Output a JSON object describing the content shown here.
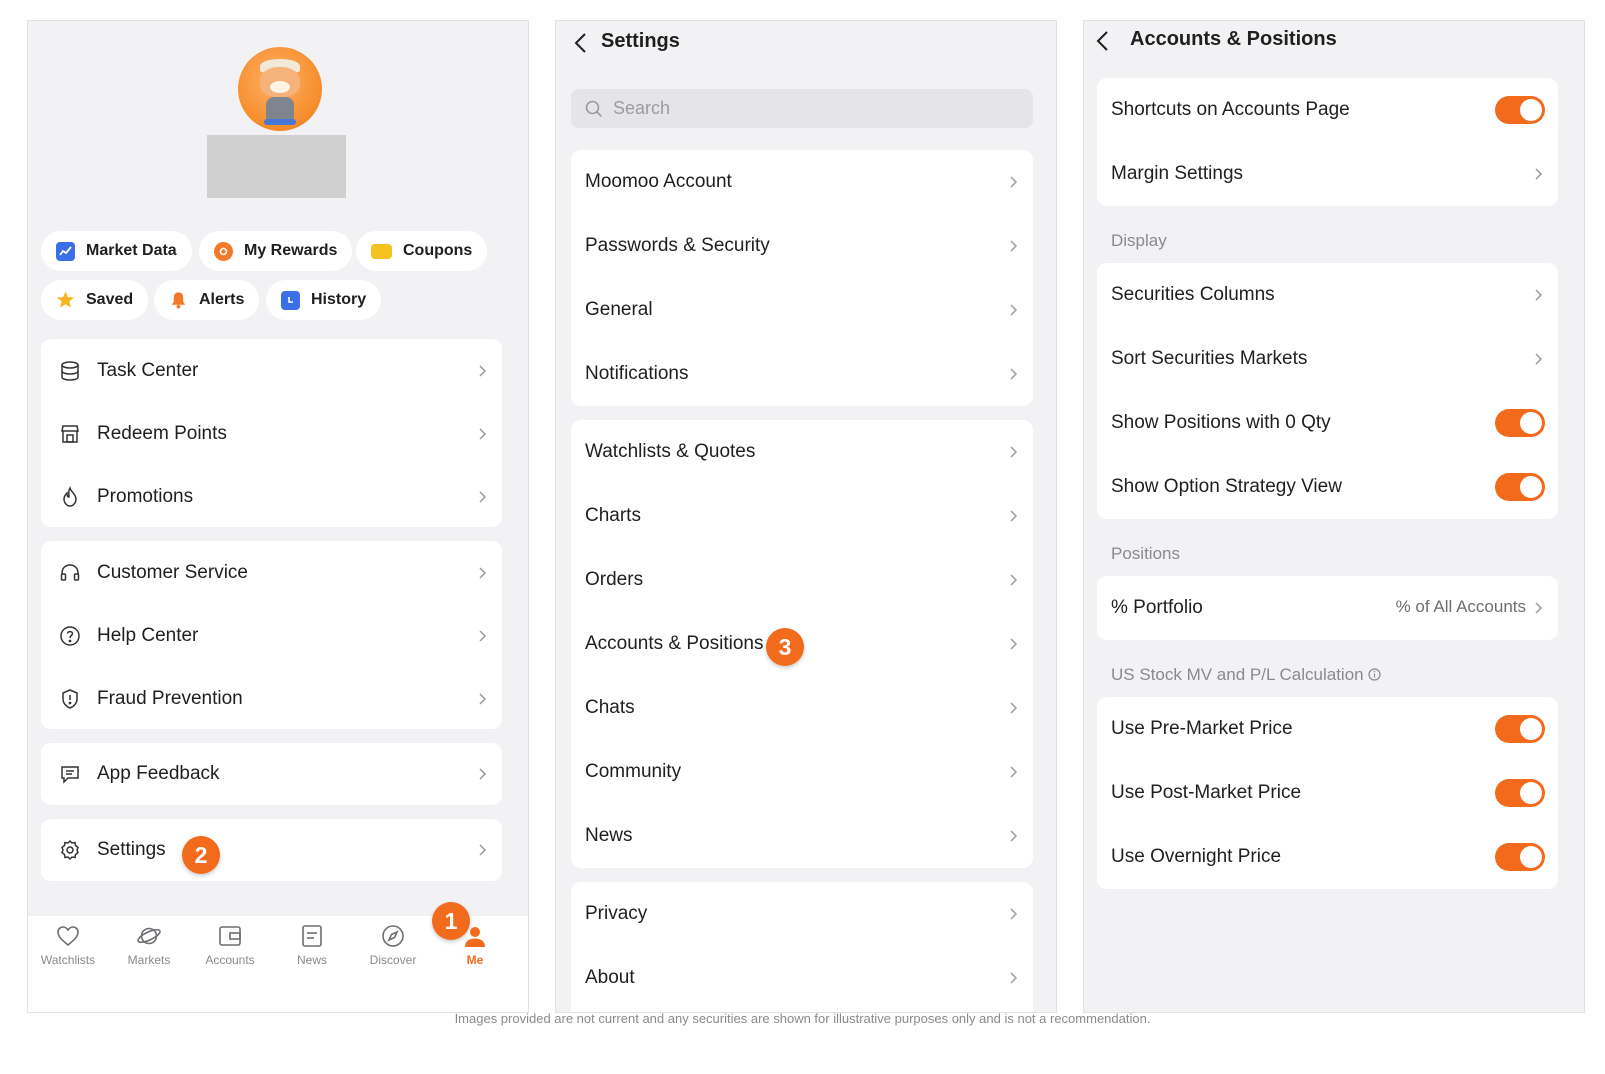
{
  "profile": {
    "chips": [
      {
        "label": "Market Data",
        "icon": "market-data-icon"
      },
      {
        "label": "My Rewards",
        "icon": "rewards-icon"
      },
      {
        "label": "Coupons",
        "icon": "coupons-icon"
      },
      {
        "label": "Saved",
        "icon": "star-icon"
      },
      {
        "label": "Alerts",
        "icon": "bell-icon"
      },
      {
        "label": "History",
        "icon": "history-icon"
      }
    ],
    "menu_group1": [
      {
        "label": "Task Center",
        "icon": "database-icon"
      },
      {
        "label": "Redeem Points",
        "icon": "store-icon"
      },
      {
        "label": "Promotions",
        "icon": "flame-icon"
      }
    ],
    "menu_group2": [
      {
        "label": "Customer Service",
        "icon": "headset-icon"
      },
      {
        "label": "Help Center",
        "icon": "question-icon"
      },
      {
        "label": "Fraud Prevention",
        "icon": "shield-icon"
      }
    ],
    "menu_group3": [
      {
        "label": "App Feedback",
        "icon": "feedback-icon"
      }
    ],
    "menu_group4": [
      {
        "label": "Settings",
        "icon": "gear-icon"
      }
    ],
    "badges": {
      "one": "1",
      "two": "2",
      "three": "3"
    },
    "tabs": [
      {
        "label": "Watchlists",
        "icon": "heart-icon"
      },
      {
        "label": "Markets",
        "icon": "planet-icon"
      },
      {
        "label": "Accounts",
        "icon": "wallet-icon"
      },
      {
        "label": "News",
        "icon": "news-icon"
      },
      {
        "label": "Discover",
        "icon": "compass-icon"
      },
      {
        "label": "Me",
        "icon": "person-icon",
        "active": true
      }
    ]
  },
  "settings": {
    "title": "Settings",
    "search_placeholder": "Search",
    "group1": [
      "Moomoo Account",
      "Passwords & Security",
      "General",
      "Notifications"
    ],
    "group2": [
      "Watchlists & Quotes",
      "Charts",
      "Orders",
      "Accounts & Positions",
      "Chats",
      "Community",
      "News"
    ],
    "group3": [
      "Privacy",
      "About"
    ]
  },
  "accounts": {
    "title": "Accounts & Positions",
    "group1": [
      {
        "label": "Shortcuts on Accounts Page",
        "type": "toggle",
        "on": true
      },
      {
        "label": "Margin Settings",
        "type": "link"
      }
    ],
    "display_header": "Display",
    "display": [
      {
        "label": "Securities Columns",
        "type": "link"
      },
      {
        "label": "Sort Securities Markets",
        "type": "link"
      },
      {
        "label": "Show Positions with 0 Qty",
        "type": "toggle",
        "on": true
      },
      {
        "label": "Show Option Strategy View",
        "type": "toggle",
        "on": true
      }
    ],
    "positions_header": "Positions",
    "positions": [
      {
        "label": "% Portfolio",
        "type": "link",
        "value": "% of All Accounts"
      }
    ],
    "calc_header": "US Stock MV and P/L Calculation",
    "calc": [
      {
        "label": "Use Pre-Market Price",
        "type": "toggle",
        "on": true
      },
      {
        "label": "Use Post-Market Price",
        "type": "toggle",
        "on": true
      },
      {
        "label": "Use Overnight Price",
        "type": "toggle",
        "on": true
      }
    ]
  },
  "colors": {
    "accent": "#f26b1d",
    "background": "#f2f2f4",
    "card": "#ffffff"
  },
  "disclaimer": "Images provided are not current and any securities are shown for illustrative purposes only and is not a recommendation."
}
